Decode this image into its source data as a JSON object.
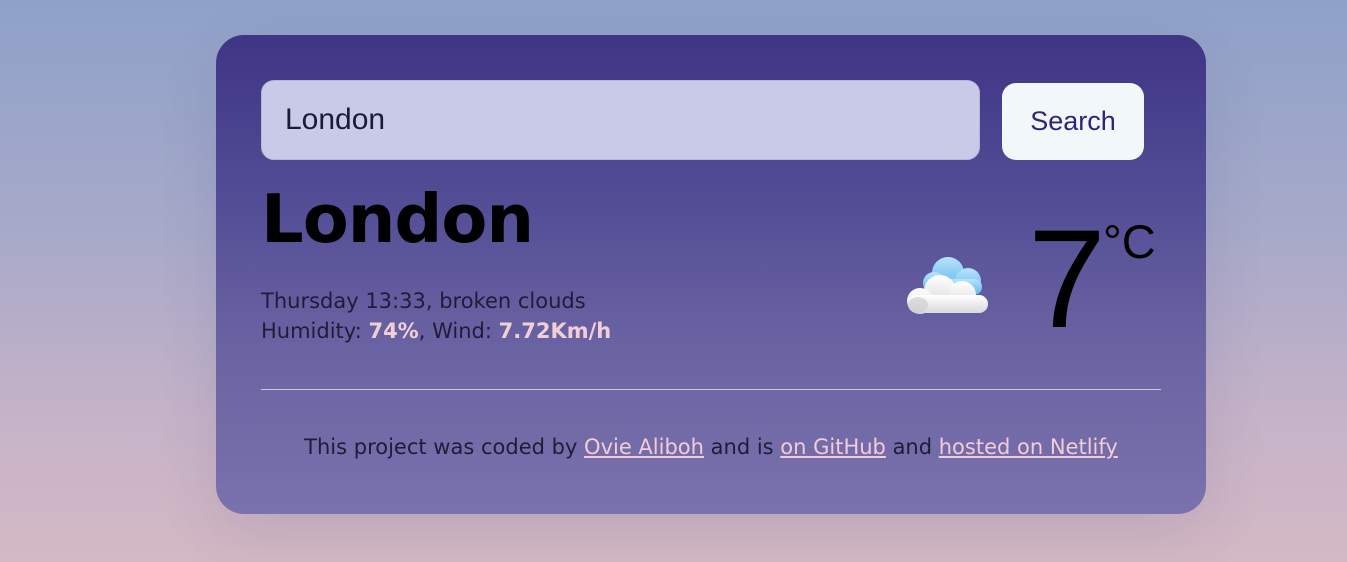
{
  "search": {
    "value": "London",
    "button_label": "Search"
  },
  "weather": {
    "city": "London",
    "day_time": "Thursday 13:33",
    "description": "broken clouds",
    "humidity_label": "Humidity:",
    "humidity_value": "74%",
    "wind_label": "Wind:",
    "wind_value": "7.72Km/h",
    "icon": "cloud-icon",
    "temperature": "7",
    "unit": "°C"
  },
  "footer": {
    "text_1": "This project was coded by ",
    "author_link": "Ovie Aliboh",
    "text_2": " and is ",
    "github_link": "on GitHub",
    "text_3": " and ",
    "netlify_link": "hosted on Netlify"
  },
  "colors": {
    "card_top": "#3e3584",
    "card_bottom": "#7a72ad",
    "highlight": "#f0d0d6",
    "search_input_bg": "#c8cae8",
    "search_button_bg": "#f2f8f9"
  }
}
